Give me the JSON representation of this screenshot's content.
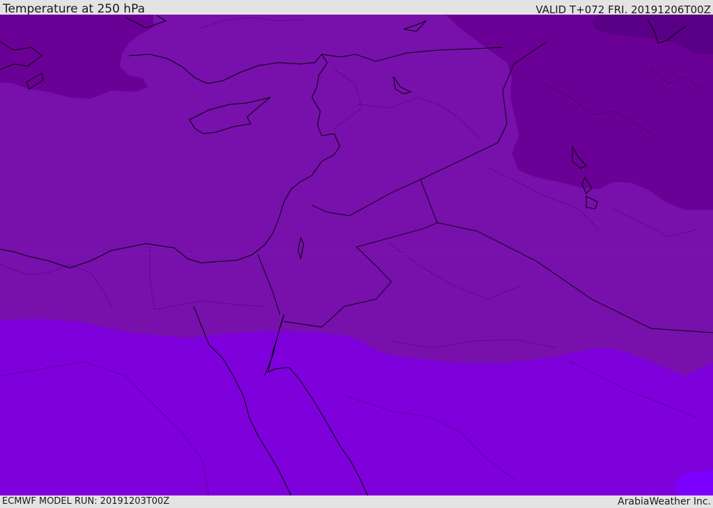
{
  "header": {
    "title": "Temperature at 250 hPa",
    "valid": "VALID T+072 FRI. 20191206T00Z"
  },
  "footer": {
    "model_run": "ECMWF MODEL RUN: 20191203T00Z",
    "credit": "ArabiaWeather Inc."
  },
  "map": {
    "region": "Eastern Mediterranean / Levant / Egypt / Iraq",
    "field": "temperature",
    "level": "250 hPa",
    "colors": {
      "coldest": "#5a0086",
      "cold": "#6b0096",
      "mid": "#7810ac",
      "warm": "#7e00da",
      "warmest": "#7c00ff",
      "boundary": "#000000"
    }
  }
}
